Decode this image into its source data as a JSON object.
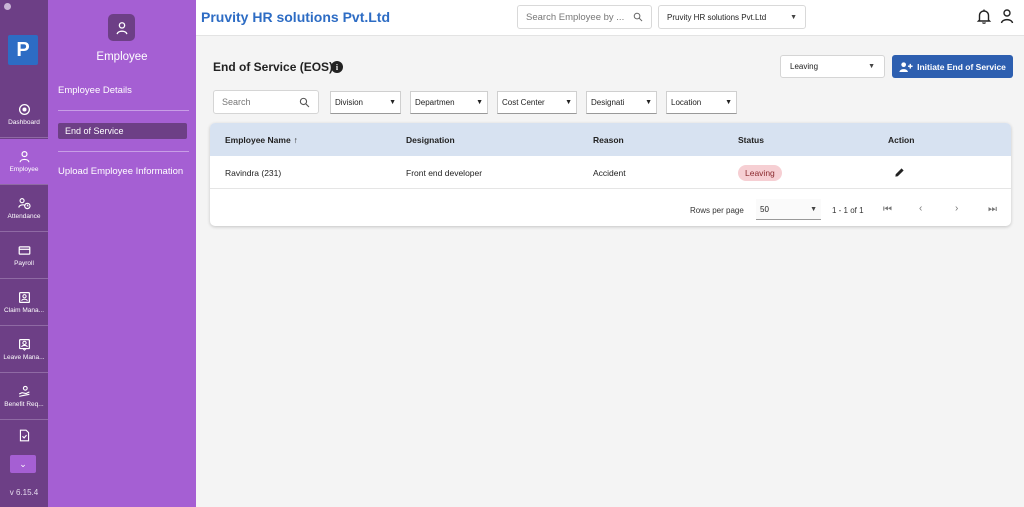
{
  "app": {
    "logo_letter": "P",
    "version": "v 6.15.4",
    "brand": "Pruvity HR solutions Pvt.Ltd"
  },
  "rail": {
    "items": [
      {
        "label": "Dashboard",
        "icon": "dashboard-icon"
      },
      {
        "label": "Employee",
        "icon": "person-icon",
        "active": true
      },
      {
        "label": "Attendance",
        "icon": "attendance-icon"
      },
      {
        "label": "Payroll",
        "icon": "payroll-icon"
      },
      {
        "label": "Claim Mana...",
        "icon": "claim-icon"
      },
      {
        "label": "Leave Mana...",
        "icon": "leave-icon"
      },
      {
        "label": "Benefit Req...",
        "icon": "benefit-icon"
      },
      {
        "label": "",
        "icon": "document-icon"
      }
    ]
  },
  "sidebar": {
    "title": "Employee",
    "items": [
      {
        "label": "Employee Details"
      },
      {
        "label": "End of Service",
        "active": true
      },
      {
        "label": "Upload Employee Information"
      }
    ]
  },
  "topbar": {
    "search_placeholder": "Search Employee by ...",
    "company": "Pruvity HR solutions Pvt.Ltd"
  },
  "main": {
    "title": "End of Service (EOS)",
    "status_filter": "Leaving",
    "initiate_label": "Initiate End of Service",
    "search_placeholder": "Search",
    "filters": [
      "Division",
      "Departmen",
      "Cost Center",
      "Designati",
      "Location"
    ],
    "table": {
      "headers": [
        "Employee Name",
        "Designation",
        "Reason",
        "Status",
        "Action"
      ],
      "sort_indicator": "↑",
      "rows": [
        {
          "name": "Ravindra  (231)",
          "designation": "Front end developer",
          "reason": "Accident",
          "status": "Leaving"
        }
      ]
    },
    "pager": {
      "rows_per_page_label": "Rows per page",
      "rows_per_page": "50",
      "range": "1 - 1 of 1"
    }
  },
  "colors": {
    "rail": "#6d3f86",
    "sidebar": "#a55fd3",
    "brand": "#2d6cc4",
    "primary_button": "#2d5fb0",
    "table_header": "#d7e2f1",
    "leaving_badge": "#f6cfd3"
  }
}
